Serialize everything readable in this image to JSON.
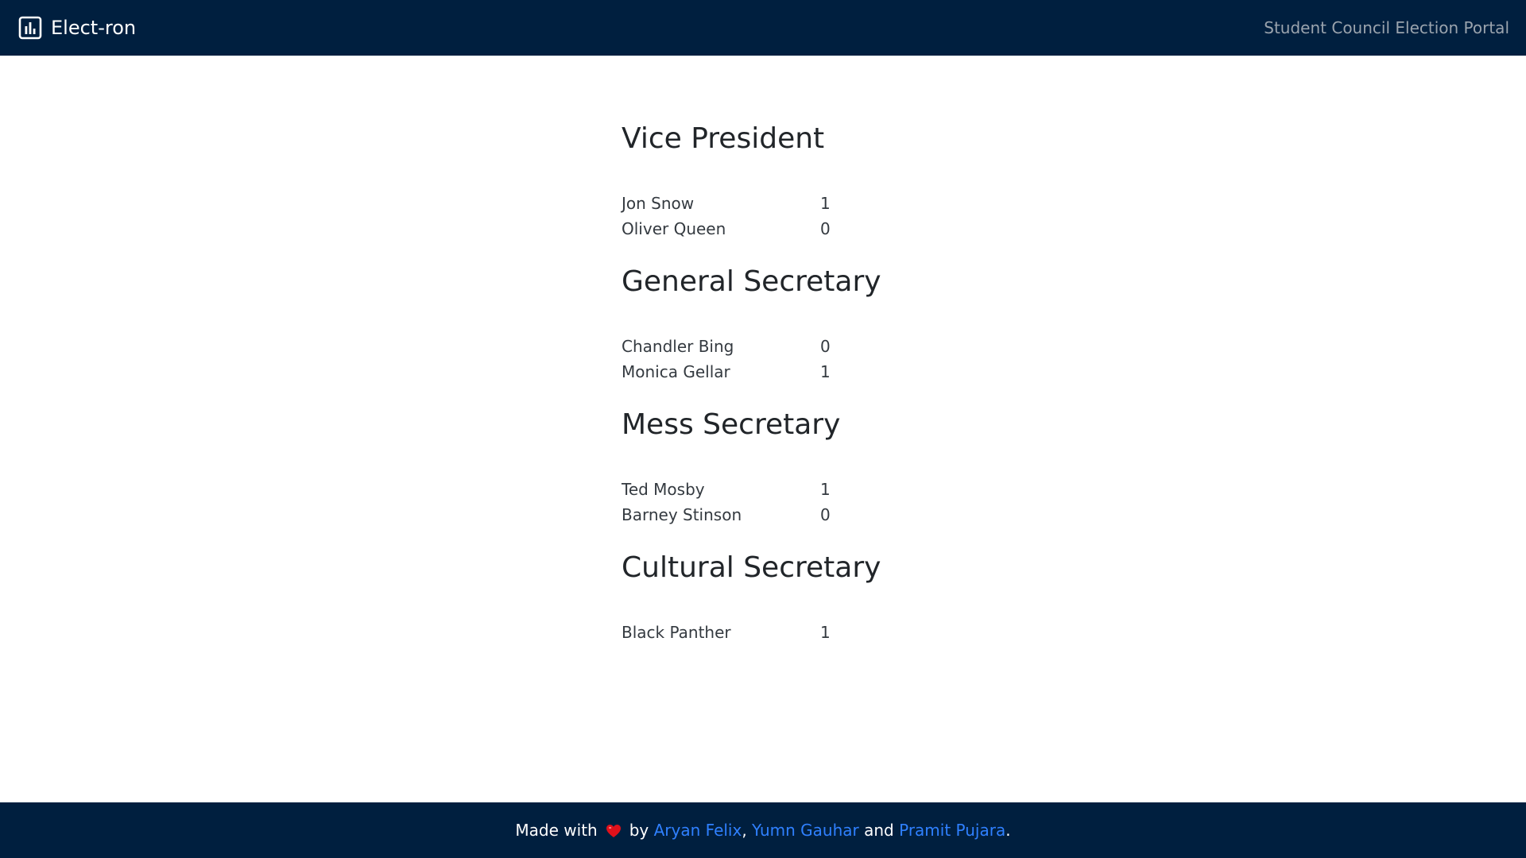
{
  "nav": {
    "brand": "Elect-ron",
    "brand_icon": "bar-chart-icon",
    "tagline": "Student Council Election Portal"
  },
  "sections": [
    {
      "title": "Vice President",
      "candidates": [
        {
          "name": "Jon Snow",
          "votes": "1"
        },
        {
          "name": "Oliver Queen",
          "votes": "0"
        }
      ]
    },
    {
      "title": "General Secretary",
      "candidates": [
        {
          "name": "Chandler Bing",
          "votes": "0"
        },
        {
          "name": "Monica Gellar",
          "votes": "1"
        }
      ]
    },
    {
      "title": "Mess Secretary",
      "candidates": [
        {
          "name": "Ted Mosby",
          "votes": "1"
        },
        {
          "name": "Barney Stinson",
          "votes": "0"
        }
      ]
    },
    {
      "title": "Cultural Secretary",
      "candidates": [
        {
          "name": "Black Panther",
          "votes": "1"
        }
      ]
    }
  ],
  "footer": {
    "made_with": "Made with",
    "heart_icon": "heart-icon",
    "by": "by",
    "author1": "Aryan Felix",
    "comma": ",",
    "author2": "Yumn Gauhar",
    "and": "and",
    "author3": "Pramit Pujara",
    "period": ".",
    "heart_color": "#e0111b",
    "link_color": "#2f80ff"
  },
  "colors": {
    "navbar_bg": "#001f3f",
    "tagline": "#9aa3ad"
  }
}
